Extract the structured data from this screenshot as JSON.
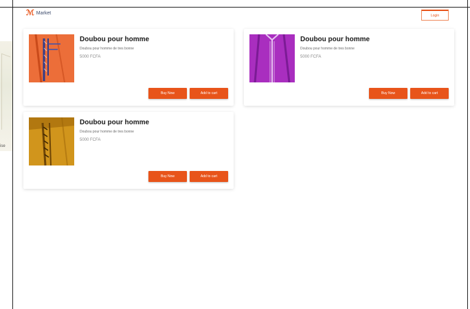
{
  "header": {
    "logo_text": "Market",
    "top_button_label": "Login"
  },
  "colors": {
    "accent": "#e8541a",
    "card_bg": "#ffffff",
    "frame": "#222222"
  },
  "left_panel": {
    "label": "ise"
  },
  "products": [
    {
      "title": "Doubou pour homme",
      "description": "Doubou pour homme de tres bonne",
      "price": "5000 FCFA",
      "buy_label": "Buy Now",
      "cart_label": "Add to cart",
      "image_icon": "orange-garment-image"
    },
    {
      "title": "Doubou pour homme",
      "description": "Doubou pour homme de tres bonne",
      "price": "5000 FCFA",
      "buy_label": "Buy Now",
      "cart_label": "Add to cart",
      "image_icon": "purple-garment-image"
    },
    {
      "title": "Doubou pour homme",
      "description": "Doubou pour homme de tres bonne",
      "price": "5000 FCFA",
      "buy_label": "Buy Now",
      "cart_label": "Add to cart",
      "image_icon": "gold-garment-image"
    }
  ]
}
